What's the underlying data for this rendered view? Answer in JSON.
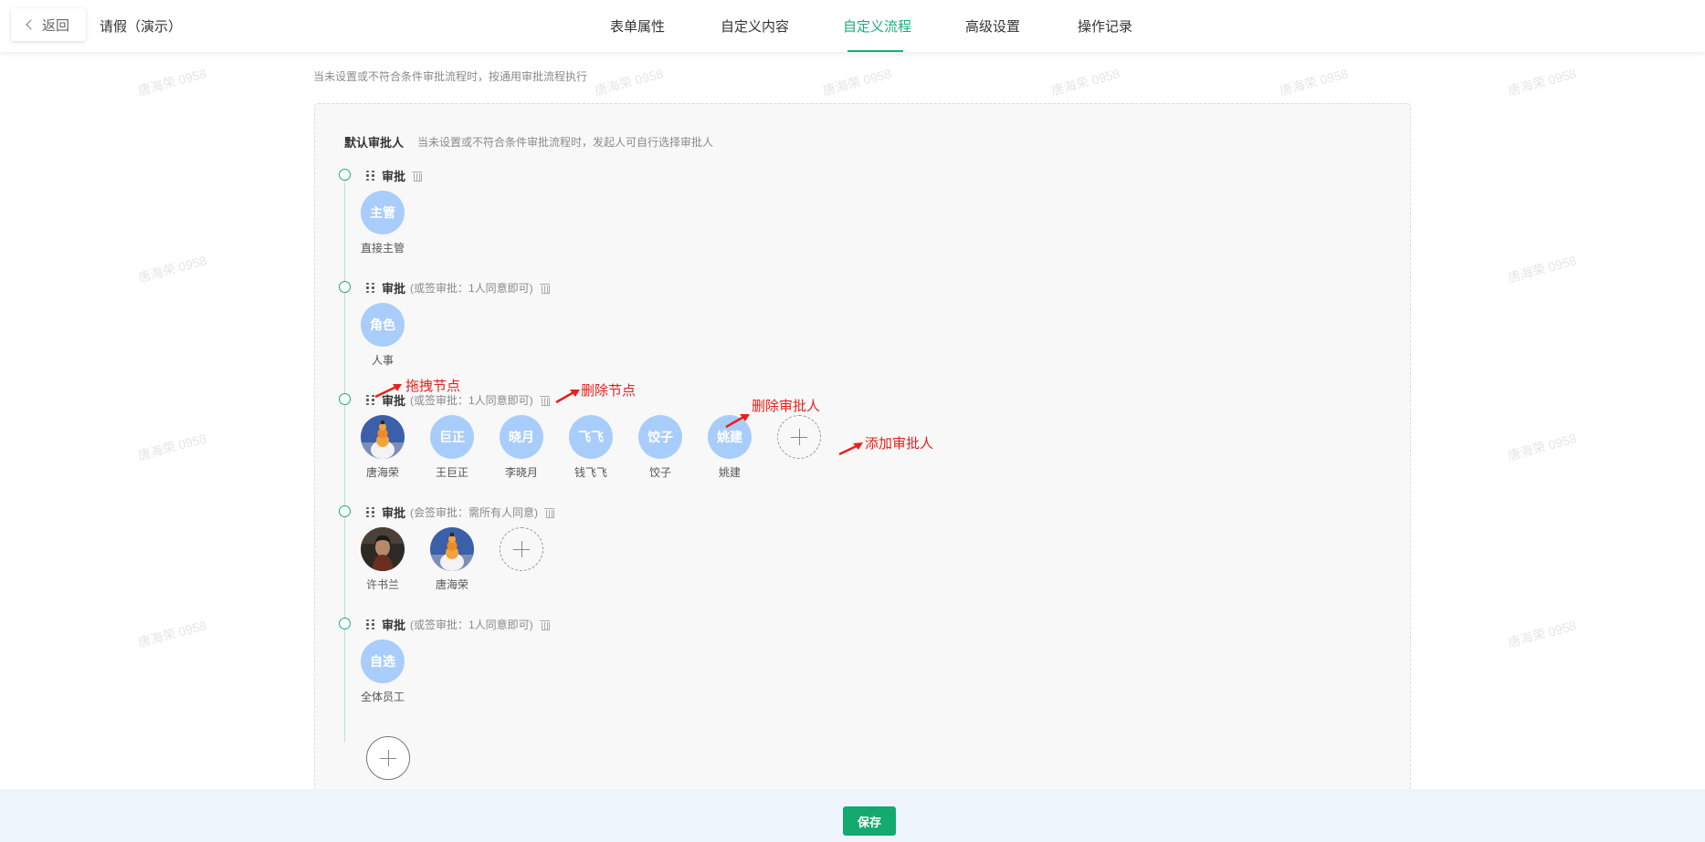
{
  "header": {
    "back_label": "返回",
    "form_title": "请假（演示）",
    "tabs": [
      {
        "label": "表单属性",
        "active": false
      },
      {
        "label": "自定义内容",
        "active": false
      },
      {
        "label": "自定义流程",
        "active": true
      },
      {
        "label": "高级设置",
        "active": false
      },
      {
        "label": "操作记录",
        "active": false
      }
    ]
  },
  "watermark_text": "唐海荣 0958",
  "top_hint": "当未设置或不符合条件审批流程时，按通用审批流程执行",
  "panel": {
    "title": "默认审批人",
    "desc": "当未设置或不符合条件审批流程时，发起人可自行选择审批人"
  },
  "nodes": [
    {
      "label": "审批",
      "mode": "",
      "approvers": [
        {
          "avatar_text": "主管",
          "name": "直接主管"
        }
      ],
      "has_add": false
    },
    {
      "label": "审批",
      "mode": "(或签审批：1人同意即可)",
      "approvers": [
        {
          "avatar_text": "角色",
          "name": "人事"
        }
      ],
      "has_add": false
    },
    {
      "label": "审批",
      "mode": "(或签审批：1人同意即可)",
      "approvers": [
        {
          "avatar_text": "",
          "name": "唐海荣",
          "photo": "cat"
        },
        {
          "avatar_text": "巨正",
          "name": "王巨正"
        },
        {
          "avatar_text": "晓月",
          "name": "李晓月"
        },
        {
          "avatar_text": "飞飞",
          "name": "钱飞飞"
        },
        {
          "avatar_text": "饺子",
          "name": "饺子"
        },
        {
          "avatar_text": "姚建",
          "name": "姚建"
        }
      ],
      "has_add": true
    },
    {
      "label": "审批",
      "mode": "(会签审批：需所有人同意)",
      "approvers": [
        {
          "avatar_text": "",
          "name": "许书兰",
          "photo": "person"
        },
        {
          "avatar_text": "",
          "name": "唐海荣",
          "photo": "cat"
        }
      ],
      "has_add": true
    },
    {
      "label": "审批",
      "mode": "(或签审批：1人同意即可)",
      "approvers": [
        {
          "avatar_text": "自选",
          "name": "全体员工"
        }
      ],
      "has_add": false
    }
  ],
  "annotations": {
    "drag_node": "拖拽节点",
    "delete_node": "删除节点",
    "delete_approver": "删除审批人",
    "add_approver": "添加审批人"
  },
  "footer": {
    "save_label": "保存"
  },
  "colors": {
    "accent": "#1aad7b",
    "save": "#13a96f",
    "avatar_bg": "#a9cdfb",
    "annotation": "#e8201a"
  },
  "icons": [
    "chevron-left-icon",
    "drag-handle-icon",
    "trash-icon",
    "plus-icon"
  ]
}
